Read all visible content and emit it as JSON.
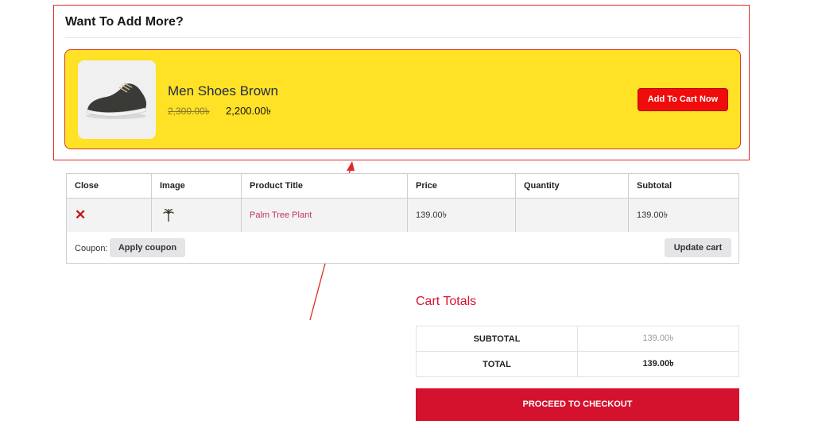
{
  "upsell": {
    "heading": "Want To Add More?",
    "product": {
      "name": "Men Shoes Brown",
      "old_price": "2,300.00৳",
      "new_price": "2,200.00৳",
      "image_icon": "shoe-icon"
    },
    "add_to_cart_label": "Add To Cart Now"
  },
  "cart": {
    "headers": [
      "Close",
      "Image",
      "Product Title",
      "Price",
      "Quantity",
      "Subtotal"
    ],
    "items": [
      {
        "remove_symbol": "✕",
        "image_icon": "palm-tree-icon",
        "title": "Palm Tree Plant",
        "price": "139.00৳",
        "quantity": "",
        "subtotal": "139.00৳"
      }
    ],
    "coupon_label": "Coupon:",
    "apply_coupon_label": "Apply coupon",
    "update_cart_label": "Update cart"
  },
  "totals": {
    "title": "Cart Totals",
    "rows": [
      {
        "label": "SUBTOTAL",
        "value": "139.00৳"
      },
      {
        "label": "TOTAL",
        "value": "139.00৳"
      }
    ],
    "checkout_label": "PROCEED TO CHECKOUT"
  },
  "colors": {
    "accent_red": "#d4122e",
    "upsell_yellow": "#ffe125",
    "annotation_red": "#e02a2a"
  }
}
